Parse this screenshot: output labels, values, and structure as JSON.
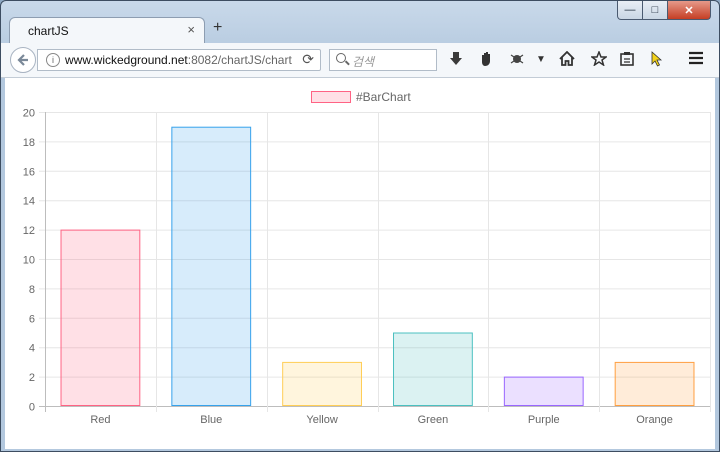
{
  "browser": {
    "tab_title": "chartJS",
    "tab_close": "×",
    "new_tab": "+",
    "url_host": "www.wickedground.net",
    "url_rest": ":8082/chartJS/chart",
    "search_placeholder": "검색",
    "window_min": "—",
    "window_max": "□",
    "window_close": "✕",
    "toolbar_icons": [
      "download-icon",
      "hand-icon",
      "bug-icon",
      "dropdown-icon",
      "home-icon",
      "star-icon",
      "clipboard-icon",
      "cursor-icon",
      "menu-icon"
    ]
  },
  "chart_data": {
    "type": "bar",
    "series": [
      {
        "name": "#BarChart",
        "values": [
          12,
          19,
          3,
          5,
          2,
          3
        ]
      }
    ],
    "categories": [
      "Red",
      "Blue",
      "Yellow",
      "Green",
      "Purple",
      "Orange"
    ],
    "values": [
      12,
      19,
      3,
      5,
      2,
      3
    ],
    "fill_colors": [
      "rgba(255,99,132,0.2)",
      "rgba(54,162,235,0.2)",
      "rgba(255,206,86,0.2)",
      "rgba(75,192,192,0.2)",
      "rgba(153,102,255,0.2)",
      "rgba(255,159,64,0.2)"
    ],
    "border_colors": [
      "#ff6384",
      "#36a2eb",
      "#ffce56",
      "#4bc0c0",
      "#9966ff",
      "#ff9f40"
    ],
    "yticks": [
      "0",
      "2",
      "4",
      "6",
      "8",
      "10",
      "12",
      "14",
      "16",
      "18",
      "20"
    ],
    "ylim": [
      0,
      20
    ],
    "grid": true,
    "legend": "top-center"
  }
}
